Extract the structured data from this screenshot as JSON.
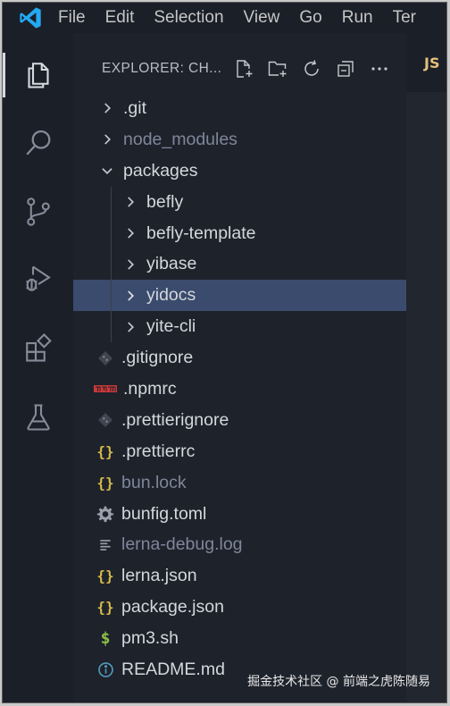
{
  "menu": [
    "File",
    "Edit",
    "Selection",
    "View",
    "Go",
    "Run",
    "Ter"
  ],
  "activity_bar": [
    {
      "icon": "explorer-icon",
      "active": true
    },
    {
      "icon": "search-icon",
      "active": false
    },
    {
      "icon": "source-control-icon",
      "active": false
    },
    {
      "icon": "run-debug-icon",
      "active": false
    },
    {
      "icon": "extensions-icon",
      "active": false
    },
    {
      "icon": "testing-icon",
      "active": false
    }
  ],
  "sidebar": {
    "title": "EXPLORER: CH..."
  },
  "tree": [
    {
      "label": ".git",
      "type": "folder",
      "depth": 0,
      "expanded": false,
      "dim": false
    },
    {
      "label": "node_modules",
      "type": "folder",
      "depth": 0,
      "expanded": false,
      "dim": true
    },
    {
      "label": "packages",
      "type": "folder",
      "depth": 0,
      "expanded": true,
      "dim": false
    },
    {
      "label": "befly",
      "type": "folder",
      "depth": 1,
      "expanded": false,
      "dim": false
    },
    {
      "label": "befly-template",
      "type": "folder",
      "depth": 1,
      "expanded": false,
      "dim": false
    },
    {
      "label": "yibase",
      "type": "folder",
      "depth": 1,
      "expanded": false,
      "dim": false
    },
    {
      "label": "yidocs",
      "type": "folder",
      "depth": 1,
      "expanded": false,
      "dim": false,
      "selected": true
    },
    {
      "label": "yite-cli",
      "type": "folder",
      "depth": 1,
      "expanded": false,
      "dim": false
    },
    {
      "label": ".gitignore",
      "type": "file",
      "icon": "git-file-icon",
      "depth": 0,
      "dim": false
    },
    {
      "label": ".npmrc",
      "type": "file",
      "icon": "npm-icon",
      "depth": 0,
      "dim": false
    },
    {
      "label": ".prettierignore",
      "type": "file",
      "icon": "git-file-icon",
      "depth": 0,
      "dim": false
    },
    {
      "label": ".prettierrc",
      "type": "file",
      "icon": "json-braces-icon",
      "depth": 0,
      "dim": false
    },
    {
      "label": "bun.lock",
      "type": "file",
      "icon": "json-braces-icon",
      "depth": 0,
      "dim": true
    },
    {
      "label": "bunfig.toml",
      "type": "file",
      "icon": "gear-icon",
      "depth": 0,
      "dim": false
    },
    {
      "label": "lerna-debug.log",
      "type": "file",
      "icon": "log-lines-icon",
      "depth": 0,
      "dim": true
    },
    {
      "label": "lerna.json",
      "type": "file",
      "icon": "json-braces-icon",
      "depth": 0,
      "dim": false
    },
    {
      "label": "package.json",
      "type": "file",
      "icon": "json-braces-icon",
      "depth": 0,
      "dim": false
    },
    {
      "label": "pm3.sh",
      "type": "file",
      "icon": "dollar-icon",
      "depth": 0,
      "dim": false
    },
    {
      "label": "README.md",
      "type": "file",
      "icon": "info-icon",
      "depth": 0,
      "dim": false
    }
  ],
  "editor": {
    "tab_badge": "JS"
  },
  "watermark": "掘金技术社区 @ 前端之虎陈随易",
  "colors": {
    "background": "#1b1f28",
    "sidebar": "#1e222b",
    "selected_row": "#3a4b6d",
    "json_icon": "#d7ba4a",
    "npm_icon": "#cb3837",
    "dollar_icon": "#8dc149",
    "info_icon": "#519aba"
  }
}
